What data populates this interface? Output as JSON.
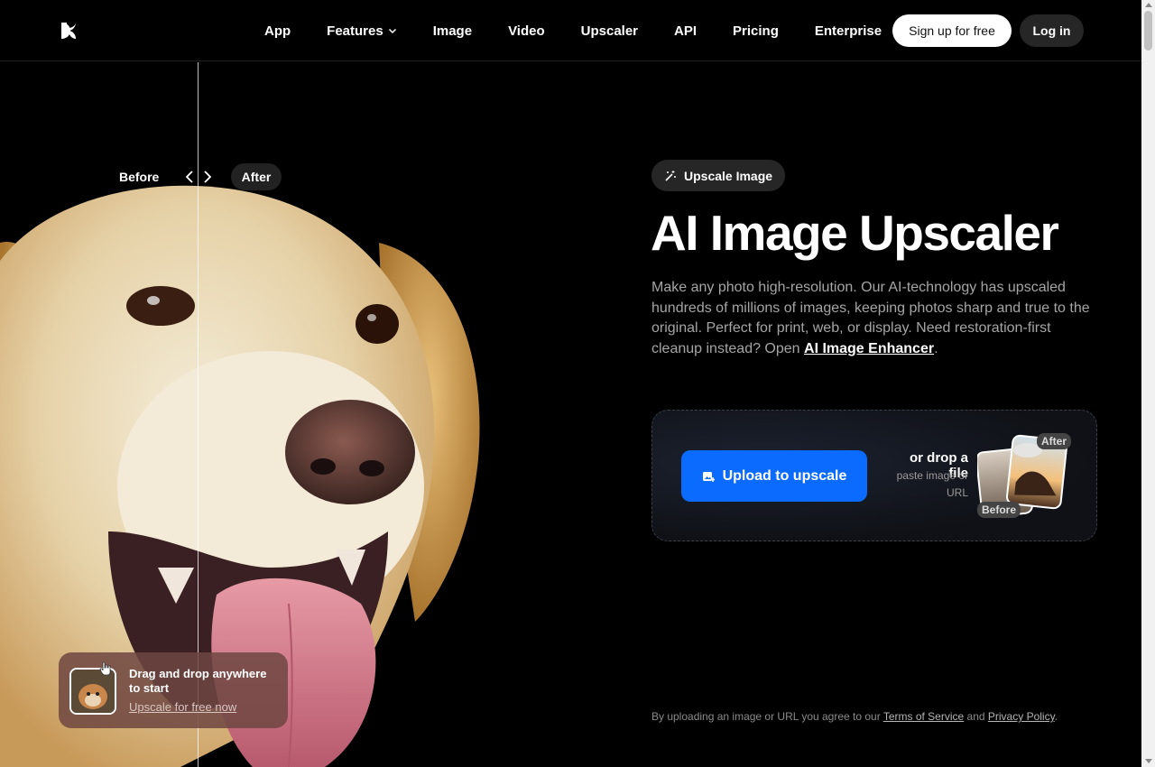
{
  "nav": {
    "links": [
      "App",
      "Features",
      "Image",
      "Video",
      "Upscaler",
      "API",
      "Pricing",
      "Enterprise"
    ],
    "signup_label": "Sign up for free",
    "login_label": "Log in"
  },
  "hero": {
    "before_label": "Before",
    "after_label": "After",
    "drag_title": "Drag and drop anywhere to start",
    "drag_link": "Upscale for free now"
  },
  "main": {
    "pill_label": "Upscale Image",
    "headline": "AI Image Upscaler",
    "desc_text": "Make any photo high-resolution. Our AI-technology has upscaled hundreds of millions of images, keeping photos sharp and true to the original. Perfect for print, web, or display. Need restoration-first cleanup instead? Open ",
    "desc_link": "AI Image Enhancer",
    "desc_end": "."
  },
  "upload": {
    "button_label": "Upload to upscale",
    "drop_title": "or drop a file",
    "drop_sub": "paste image or URL",
    "after_tag": "After",
    "before_tag": "Before"
  },
  "terms": {
    "prefix": "By uploading an image or URL you agree to our ",
    "tos": "Terms of Service",
    "and": " and ",
    "privacy": "Privacy Policy",
    "suffix": "."
  },
  "colors": {
    "accent": "#0b6bff",
    "background": "#000000"
  }
}
